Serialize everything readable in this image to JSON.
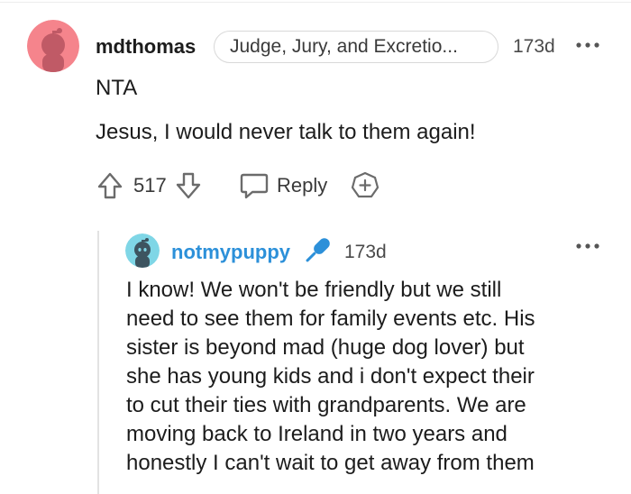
{
  "parent_comment": {
    "username": "mdthomas",
    "flair": "Judge, Jury, and Excretio...",
    "timestamp": "173d",
    "lines": [
      "NTA",
      "Jesus, I would never talk to them again!"
    ],
    "vote_count": "517",
    "reply_label": "Reply",
    "avatar_color": "#f5848c"
  },
  "reply_comment": {
    "username": "notmypuppy",
    "timestamp": "173d",
    "username_color": "#2c90d9",
    "avatar_color": "#7fd6e6",
    "mic_color": "#2c90d9",
    "body_lines": [
      "I know! We won't be friendly but we still",
      "need to see them for family events etc. His",
      "sister is beyond mad (huge dog lover) but",
      "she has young kids and i don't expect their",
      "to cut their ties with grandparents. We are",
      "moving back to Ireland in two years and",
      "honestly I can't wait to get away from them"
    ]
  },
  "icons": {
    "upvote": "arrow-up-icon",
    "downvote": "arrow-down-icon",
    "reply": "speech-bubble-icon",
    "award": "award-plus-icon",
    "more": "ellipsis-icon",
    "mic": "microphone-icon"
  }
}
